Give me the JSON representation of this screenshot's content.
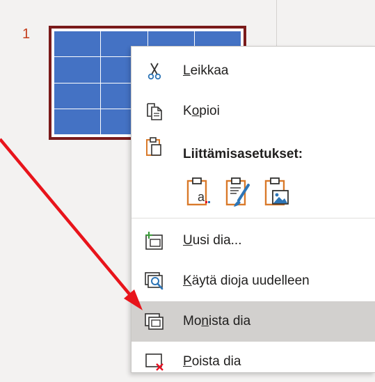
{
  "thumbnail": {
    "slide_number": "1",
    "rows": 4,
    "cols": 4
  },
  "context_menu": {
    "cut": {
      "pre": "",
      "key": "L",
      "post": "eikkaa"
    },
    "copy": {
      "pre": "K",
      "key": "o",
      "post": "pioi"
    },
    "paste_options_label": "Liittämisasetukset:",
    "new_slide": {
      "pre": "",
      "key": "U",
      "post": "usi dia..."
    },
    "reuse_slides": {
      "pre": "",
      "key": "K",
      "post": "äytä dioja uudelleen"
    },
    "duplicate_slide": {
      "pre": "Mo",
      "key": "n",
      "post": "ista dia"
    },
    "delete_slide": {
      "pre": "",
      "key": "P",
      "post": "oista dia"
    }
  },
  "colors": {
    "accent_orange": "#d97a2b",
    "thumbnail_border": "#7a1b1b",
    "table_fill": "#4472c4",
    "arrow": "#e8141b",
    "highlight": "#d2d0ce"
  }
}
